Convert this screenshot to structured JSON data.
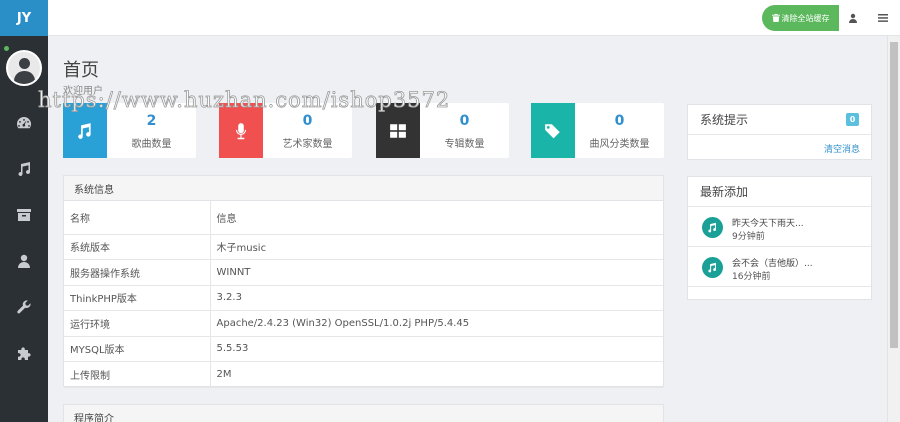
{
  "brand": "JY",
  "topbar": {
    "clear_cache_label": "清除全站缓存"
  },
  "page": {
    "title": "首页",
    "subtitle": "欢迎用户",
    "watermark": "https://www.huzhan.com/ishop3572"
  },
  "stats": [
    {
      "value": "2",
      "label": "歌曲数量",
      "icon": "music-note-icon",
      "color": "#2aa1d6"
    },
    {
      "value": "0",
      "label": "艺术家数量",
      "icon": "microphone-icon",
      "color": "#f05050"
    },
    {
      "value": "0",
      "label": "专辑数量",
      "icon": "grid-icon",
      "color": "#333333"
    },
    {
      "value": "0",
      "label": "曲风分类数量",
      "icon": "tags-icon",
      "color": "#1ab5a8"
    }
  ],
  "system_info": {
    "title": "系统信息",
    "header": [
      "名称",
      "信息"
    ],
    "rows": [
      [
        "系统版本",
        "木子music"
      ],
      [
        "服务器操作系统",
        "WINNT"
      ],
      [
        "ThinkPHP版本",
        "3.2.3"
      ],
      [
        "运行环境",
        "Apache/2.4.23 (Win32) OpenSSL/1.0.2j PHP/5.4.45"
      ],
      [
        "MYSQL版本",
        "5.5.53"
      ],
      [
        "上传限制",
        "2M"
      ]
    ]
  },
  "program_intro": {
    "title": "程序简介"
  },
  "notices": {
    "title": "系统提示",
    "count": "0",
    "clear_label": "清空消息"
  },
  "latest": {
    "title": "最新添加",
    "items": [
      {
        "title": "昨天今天下雨天...",
        "time": "9分钟前"
      },
      {
        "title": "会不会（吉他版）...",
        "time": "16分钟前"
      }
    ]
  },
  "colors": {
    "sidebar": "#2b3035",
    "brand": "#2a8fc7",
    "success": "#5cb85c",
    "accent": "#2f8fcf"
  }
}
